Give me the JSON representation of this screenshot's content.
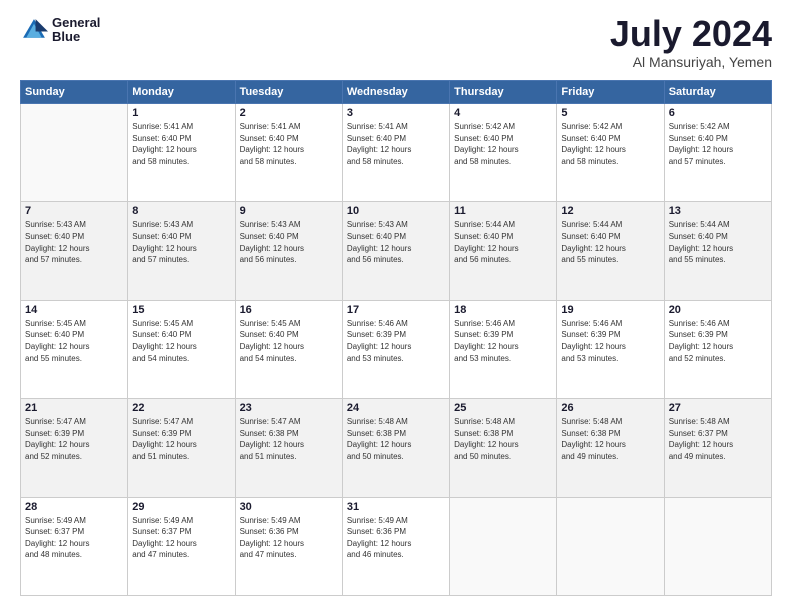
{
  "header": {
    "logo_line1": "General",
    "logo_line2": "Blue",
    "month_year": "July 2024",
    "location": "Al Mansuriyah, Yemen"
  },
  "weekdays": [
    "Sunday",
    "Monday",
    "Tuesday",
    "Wednesday",
    "Thursday",
    "Friday",
    "Saturday"
  ],
  "weeks": [
    [
      {
        "day": "",
        "info": ""
      },
      {
        "day": "1",
        "info": "Sunrise: 5:41 AM\nSunset: 6:40 PM\nDaylight: 12 hours\nand 58 minutes."
      },
      {
        "day": "2",
        "info": "Sunrise: 5:41 AM\nSunset: 6:40 PM\nDaylight: 12 hours\nand 58 minutes."
      },
      {
        "day": "3",
        "info": "Sunrise: 5:41 AM\nSunset: 6:40 PM\nDaylight: 12 hours\nand 58 minutes."
      },
      {
        "day": "4",
        "info": "Sunrise: 5:42 AM\nSunset: 6:40 PM\nDaylight: 12 hours\nand 58 minutes."
      },
      {
        "day": "5",
        "info": "Sunrise: 5:42 AM\nSunset: 6:40 PM\nDaylight: 12 hours\nand 58 minutes."
      },
      {
        "day": "6",
        "info": "Sunrise: 5:42 AM\nSunset: 6:40 PM\nDaylight: 12 hours\nand 57 minutes."
      }
    ],
    [
      {
        "day": "7",
        "info": "Sunrise: 5:43 AM\nSunset: 6:40 PM\nDaylight: 12 hours\nand 57 minutes."
      },
      {
        "day": "8",
        "info": "Sunrise: 5:43 AM\nSunset: 6:40 PM\nDaylight: 12 hours\nand 57 minutes."
      },
      {
        "day": "9",
        "info": "Sunrise: 5:43 AM\nSunset: 6:40 PM\nDaylight: 12 hours\nand 56 minutes."
      },
      {
        "day": "10",
        "info": "Sunrise: 5:43 AM\nSunset: 6:40 PM\nDaylight: 12 hours\nand 56 minutes."
      },
      {
        "day": "11",
        "info": "Sunrise: 5:44 AM\nSunset: 6:40 PM\nDaylight: 12 hours\nand 56 minutes."
      },
      {
        "day": "12",
        "info": "Sunrise: 5:44 AM\nSunset: 6:40 PM\nDaylight: 12 hours\nand 55 minutes."
      },
      {
        "day": "13",
        "info": "Sunrise: 5:44 AM\nSunset: 6:40 PM\nDaylight: 12 hours\nand 55 minutes."
      }
    ],
    [
      {
        "day": "14",
        "info": "Sunrise: 5:45 AM\nSunset: 6:40 PM\nDaylight: 12 hours\nand 55 minutes."
      },
      {
        "day": "15",
        "info": "Sunrise: 5:45 AM\nSunset: 6:40 PM\nDaylight: 12 hours\nand 54 minutes."
      },
      {
        "day": "16",
        "info": "Sunrise: 5:45 AM\nSunset: 6:40 PM\nDaylight: 12 hours\nand 54 minutes."
      },
      {
        "day": "17",
        "info": "Sunrise: 5:46 AM\nSunset: 6:39 PM\nDaylight: 12 hours\nand 53 minutes."
      },
      {
        "day": "18",
        "info": "Sunrise: 5:46 AM\nSunset: 6:39 PM\nDaylight: 12 hours\nand 53 minutes."
      },
      {
        "day": "19",
        "info": "Sunrise: 5:46 AM\nSunset: 6:39 PM\nDaylight: 12 hours\nand 53 minutes."
      },
      {
        "day": "20",
        "info": "Sunrise: 5:46 AM\nSunset: 6:39 PM\nDaylight: 12 hours\nand 52 minutes."
      }
    ],
    [
      {
        "day": "21",
        "info": "Sunrise: 5:47 AM\nSunset: 6:39 PM\nDaylight: 12 hours\nand 52 minutes."
      },
      {
        "day": "22",
        "info": "Sunrise: 5:47 AM\nSunset: 6:39 PM\nDaylight: 12 hours\nand 51 minutes."
      },
      {
        "day": "23",
        "info": "Sunrise: 5:47 AM\nSunset: 6:38 PM\nDaylight: 12 hours\nand 51 minutes."
      },
      {
        "day": "24",
        "info": "Sunrise: 5:48 AM\nSunset: 6:38 PM\nDaylight: 12 hours\nand 50 minutes."
      },
      {
        "day": "25",
        "info": "Sunrise: 5:48 AM\nSunset: 6:38 PM\nDaylight: 12 hours\nand 50 minutes."
      },
      {
        "day": "26",
        "info": "Sunrise: 5:48 AM\nSunset: 6:38 PM\nDaylight: 12 hours\nand 49 minutes."
      },
      {
        "day": "27",
        "info": "Sunrise: 5:48 AM\nSunset: 6:37 PM\nDaylight: 12 hours\nand 49 minutes."
      }
    ],
    [
      {
        "day": "28",
        "info": "Sunrise: 5:49 AM\nSunset: 6:37 PM\nDaylight: 12 hours\nand 48 minutes."
      },
      {
        "day": "29",
        "info": "Sunrise: 5:49 AM\nSunset: 6:37 PM\nDaylight: 12 hours\nand 47 minutes."
      },
      {
        "day": "30",
        "info": "Sunrise: 5:49 AM\nSunset: 6:36 PM\nDaylight: 12 hours\nand 47 minutes."
      },
      {
        "day": "31",
        "info": "Sunrise: 5:49 AM\nSunset: 6:36 PM\nDaylight: 12 hours\nand 46 minutes."
      },
      {
        "day": "",
        "info": ""
      },
      {
        "day": "",
        "info": ""
      },
      {
        "day": "",
        "info": ""
      }
    ]
  ]
}
